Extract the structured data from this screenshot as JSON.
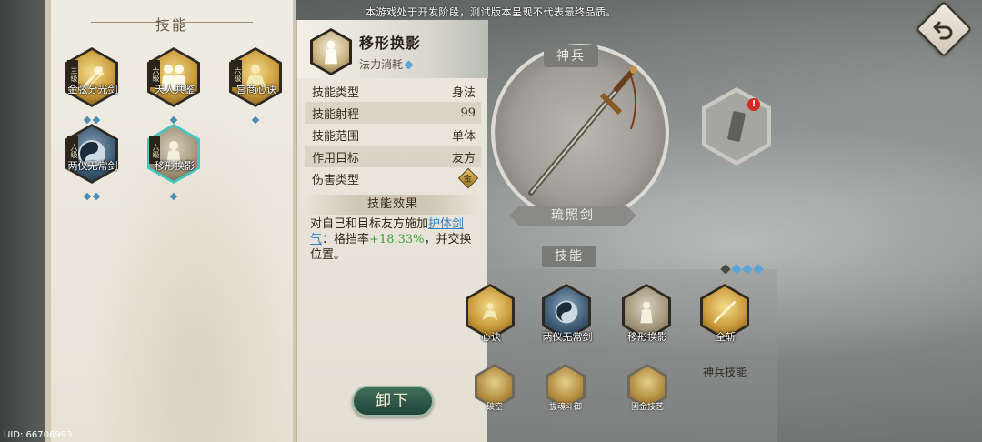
{
  "notice": "本游戏处于开发阶段，测试版本呈现不代表最终品质。",
  "uid": "UID: 66706993",
  "skill_panel": {
    "title": "技能",
    "skills": [
      {
        "name": "金弦分光剑",
        "level": "三级",
        "style": "gold",
        "dots": 2
      },
      {
        "name": "天人共鉴",
        "level": "六级",
        "style": "gold",
        "dots": 1
      },
      {
        "name": "宫商心诀",
        "level": "六级",
        "style": "gold",
        "dots": 1
      },
      {
        "name": "两仪无常剑",
        "level": "六级",
        "style": "blue",
        "dots": 2
      },
      {
        "name": "移形换影",
        "level": "六级",
        "style": "grey",
        "dots": 1,
        "selected": true
      }
    ]
  },
  "detail": {
    "name": "移形换影",
    "mana_label": "法力消耗",
    "attributes": [
      {
        "label": "技能类型",
        "value": "身法"
      },
      {
        "label": "技能射程",
        "value": "99"
      },
      {
        "label": "技能范围",
        "value": "单体"
      },
      {
        "label": "作用目标",
        "value": "友方"
      },
      {
        "label": "伤害类型",
        "value": "金",
        "icon": "metal-element-icon"
      }
    ],
    "effect_title": "技能效果",
    "effect_pre": "对自己和目标友方施加",
    "effect_link": "护体剑气",
    "effect_mid": "：格挡率",
    "effect_value": "+18.33%",
    "effect_post": "，并交换位置。",
    "unequip_label": "卸下"
  },
  "weapon": {
    "section_title": "神兵",
    "name": "琉照剑"
  },
  "equipped_skills": {
    "section_title": "技能",
    "main": [
      {
        "name": "心诀",
        "style": "gold"
      },
      {
        "name": "两仪无常剑",
        "style": "blue"
      },
      {
        "name": "移形换影",
        "style": "grey"
      },
      {
        "name": "全斩",
        "style": "gold"
      }
    ],
    "weapon_skill_label": "神兵技能",
    "sub": [
      {
        "name": "破空"
      },
      {
        "name": "拔魂斗御"
      },
      {
        "name": "固金技艺"
      }
    ]
  },
  "colors": {
    "accent_teal": "#45c7c0",
    "link_blue": "#2f7fc0",
    "positive_green": "#3aa33a",
    "button_green": "#1f4538",
    "alert_red": "#d22b22"
  }
}
